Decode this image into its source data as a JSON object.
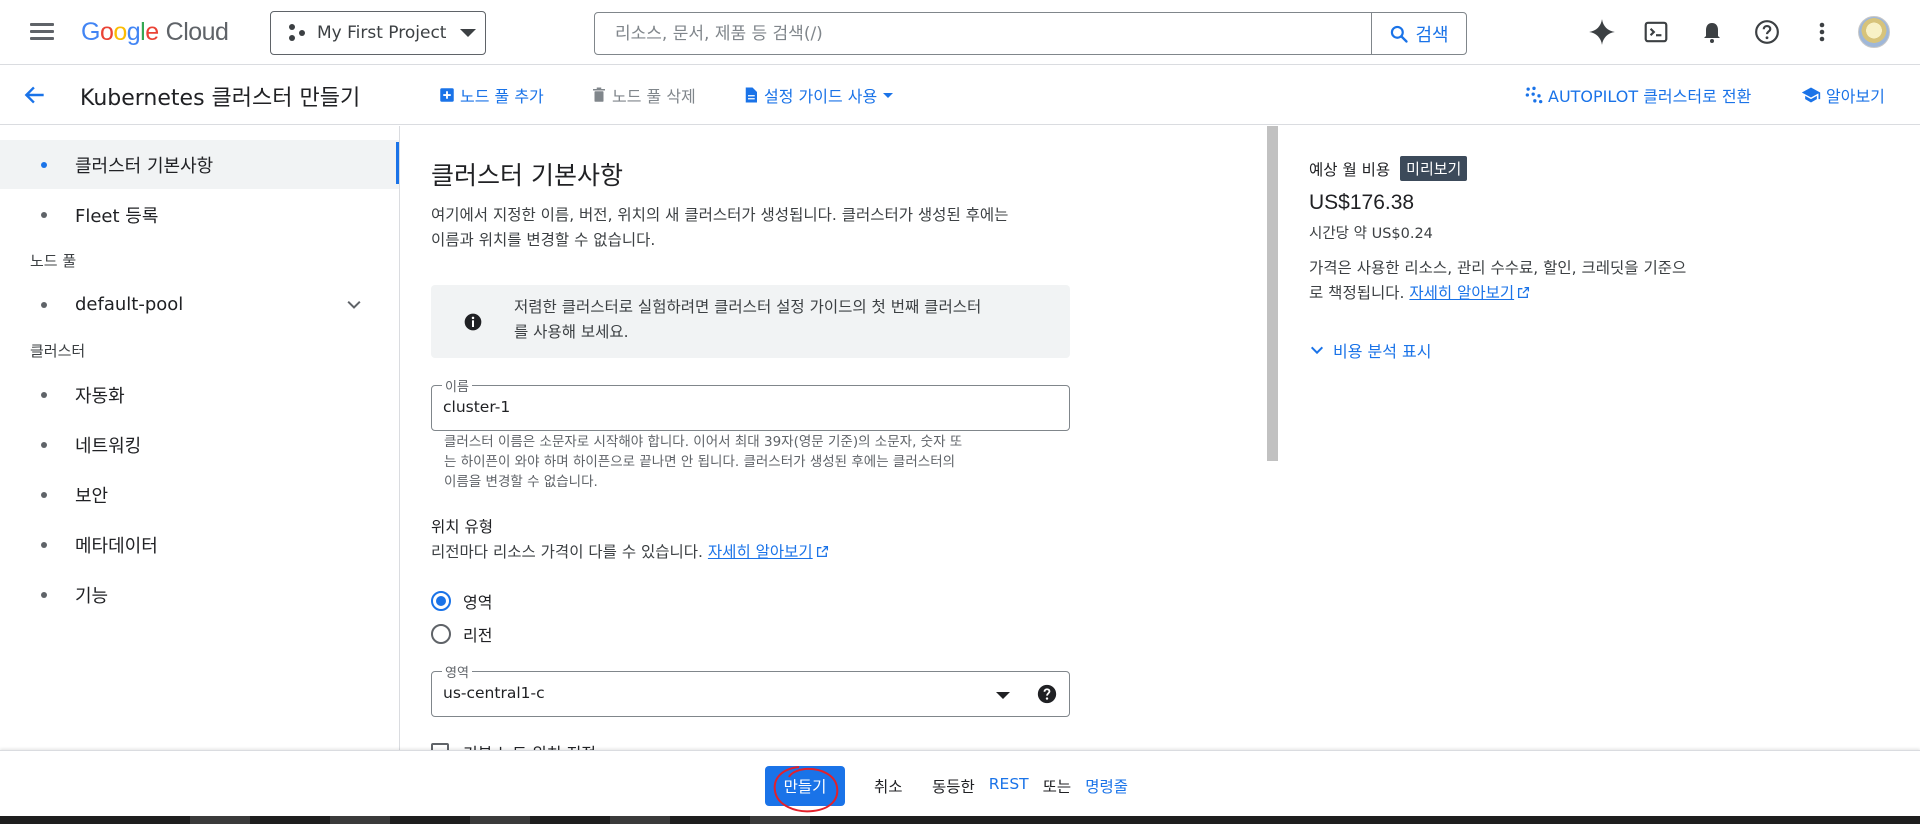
{
  "topbar": {
    "logo_google": "Google",
    "logo_cloud": "Cloud",
    "project_name": "My First Project",
    "search_placeholder": "리소스, 문서, 제품 등 검색(/)",
    "search_button": "검색"
  },
  "subbar": {
    "title": "Kubernetes 클러스터 만들기",
    "add_node_pool": "노드 풀 추가",
    "delete_node_pool": "노드 풀 삭제",
    "setup_guide": "설정 가이드 사용",
    "autopilot": "AUTOPILOT 클러스터로 전환",
    "learn": "알아보기"
  },
  "leftnav": {
    "items_top": [
      {
        "label": "클러스터 기본사항",
        "active": true
      },
      {
        "label": "Fleet 등록",
        "active": false
      }
    ],
    "section_node_pool": "노드 풀",
    "node_pool_item": "default-pool",
    "section_cluster": "클러스터",
    "items_cluster": [
      {
        "label": "자동화"
      },
      {
        "label": "네트워킹"
      },
      {
        "label": "보안"
      },
      {
        "label": "메타데이터"
      },
      {
        "label": "기능"
      }
    ]
  },
  "main": {
    "section_title": "클러스터 기본사항",
    "desc_line1": "여기에서 지정한 이름, 버전, 위치의 새 클러스터가 생성됩니다. 클러스터가 생성된 후에는",
    "desc_line2": "이름과 위치를 변경할 수 없습니다.",
    "info_line1": "저렴한 클러스터로 실험하려면 클러스터 설정 가이드의 첫 번째 클러스터",
    "info_line2": "를 사용해 보세요.",
    "name_label": "이름",
    "name_value": "cluster-1",
    "name_hint_1": "클러스터 이름은 소문자로 시작해야 합니다. 이어서 최대 39자(영문 기준)의 소문자, 숫자 또",
    "name_hint_2": "는 하이픈이 와야 하며 하이픈으로 끝나면 안 됩니다. 클러스터가 생성된 후에는 클러스터의",
    "name_hint_3": "이름을 변경할 수 없습니다.",
    "location_type_title": "위치 유형",
    "location_type_desc": "리전마다 리소스 가격이 다를 수 있습니다.",
    "learn_more": "자세히 알아보기",
    "radio_zone": "영역",
    "radio_region": "리전",
    "zone_label": "영역",
    "zone_value": "us-central1-c",
    "checkbox_partial": "기본 노드 위치 지정"
  },
  "cost": {
    "label": "예상 월 비용",
    "badge": "미리보기",
    "monthly": "US$176.38",
    "hourly": "시간당 약 US$0.24",
    "desc_line1": "가격은 사용한 리소스, 관리 수수료, 할인, 크레딧을 기준으",
    "desc_line2": "로 책정됩니다.",
    "learn_more": "자세히 알아보기",
    "breakdown": "비용 분석 표시"
  },
  "bottombar": {
    "create": "만들기",
    "cancel": "취소",
    "equivalent": "동등한",
    "rest": "REST",
    "or": "또는",
    "command_line": "명령줄"
  },
  "colors": {
    "accent": "#1a73e8",
    "annotation": "#e2212b"
  }
}
